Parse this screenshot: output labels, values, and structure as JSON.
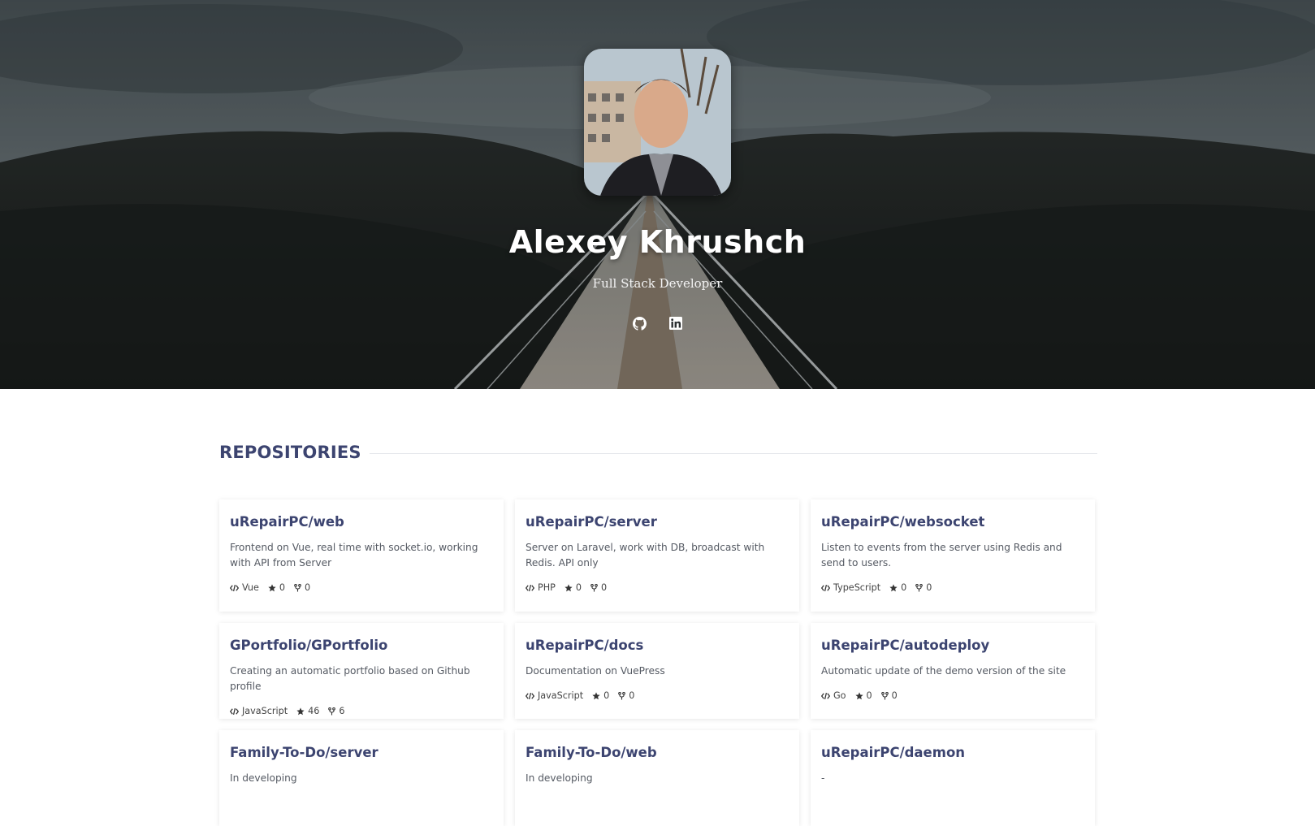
{
  "profile": {
    "name": "Alexey Khrushch",
    "subtitle": "Full Stack Developer"
  },
  "socials": [
    {
      "icon": "github-icon"
    },
    {
      "icon": "linkedin-icon"
    }
  ],
  "section": {
    "title": "REPOSITORIES"
  },
  "repos": [
    {
      "name": "uRepairPC/web",
      "description": "Frontend on Vue, real time with socket.io, working with API from Server",
      "language": "Vue",
      "stars": "0",
      "forks": "0"
    },
    {
      "name": "uRepairPC/server",
      "description": "Server on Laravel, work with DB, broadcast with Redis. API only",
      "language": "PHP",
      "stars": "0",
      "forks": "0"
    },
    {
      "name": "uRepairPC/websocket",
      "description": "Listen to events from the server using Redis and send to users.",
      "language": "TypeScript",
      "stars": "0",
      "forks": "0"
    },
    {
      "name": "GPortfolio/GPortfolio",
      "description": "Creating an automatic portfolio based on Github profile",
      "language": "JavaScript",
      "stars": "46",
      "forks": "6"
    },
    {
      "name": "uRepairPC/docs",
      "description": "Documentation on VuePress",
      "language": "JavaScript",
      "stars": "0",
      "forks": "0"
    },
    {
      "name": "uRepairPC/autodeploy",
      "description": "Automatic update of the demo version of the site",
      "language": "Go",
      "stars": "0",
      "forks": "0"
    },
    {
      "name": "Family-To-Do/server",
      "description": "In developing",
      "language": "",
      "stars": "",
      "forks": ""
    },
    {
      "name": "Family-To-Do/web",
      "description": "In developing",
      "language": "",
      "stars": "",
      "forks": ""
    },
    {
      "name": "uRepairPC/daemon",
      "description": "-",
      "language": "",
      "stars": "",
      "forks": ""
    }
  ],
  "colors": {
    "accent": "#3c4470",
    "text": "#555a63"
  }
}
